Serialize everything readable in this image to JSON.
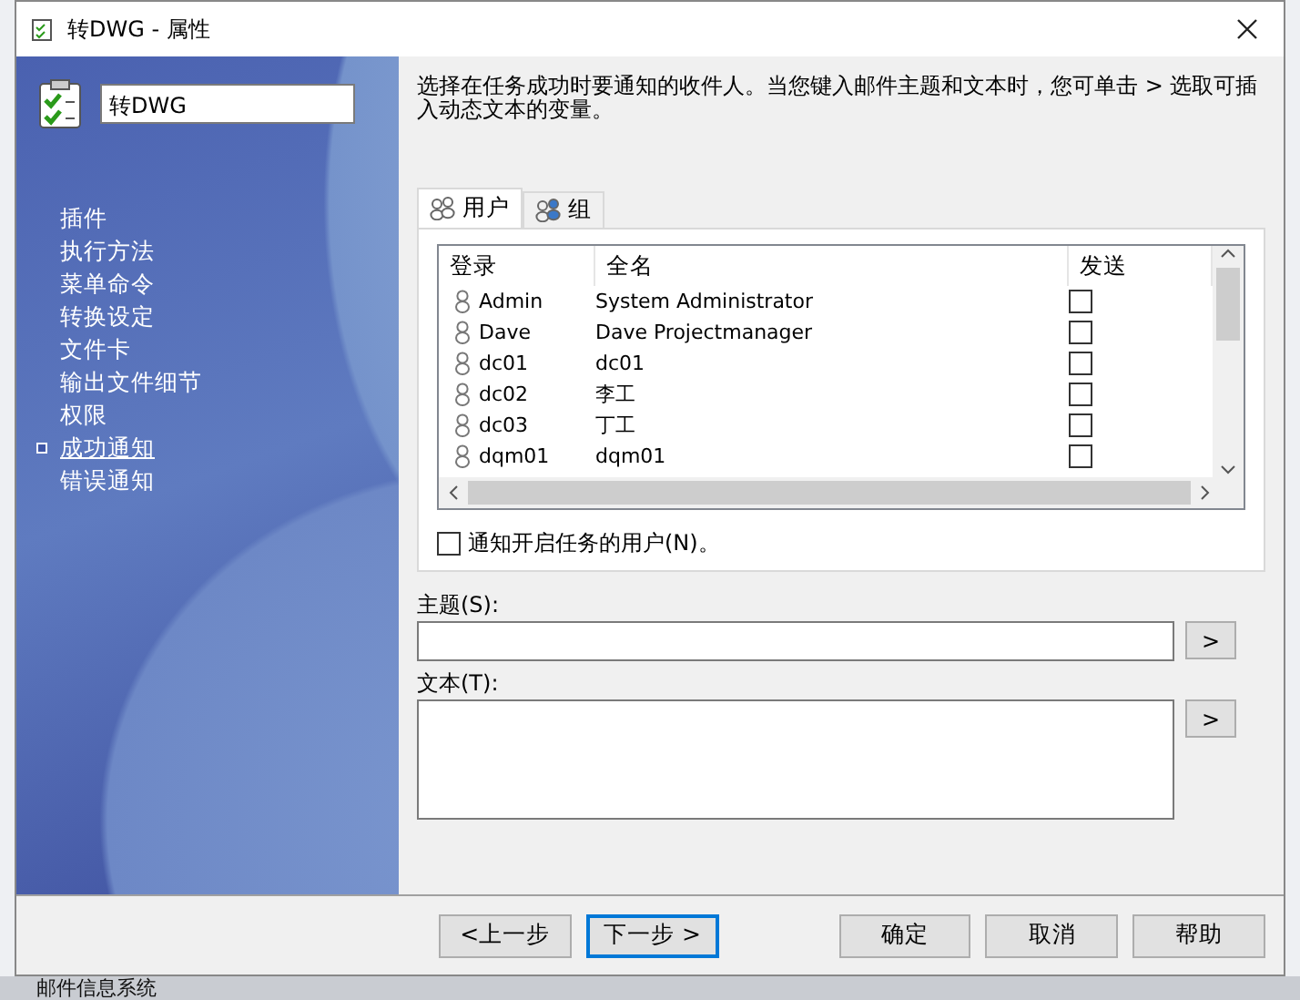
{
  "window": {
    "title": "转DWG - 属性"
  },
  "sidebar": {
    "name": "转DWG",
    "items": [
      {
        "label": "插件",
        "selected": false
      },
      {
        "label": "执行方法",
        "selected": false
      },
      {
        "label": "菜单命令",
        "selected": false
      },
      {
        "label": "转换设定",
        "selected": false
      },
      {
        "label": "文件卡",
        "selected": false
      },
      {
        "label": "输出文件细节",
        "selected": false
      },
      {
        "label": "权限",
        "selected": false
      },
      {
        "label": "成功通知",
        "selected": true
      },
      {
        "label": "错误通知",
        "selected": false
      }
    ]
  },
  "description": "选择在任务成功时要通知的收件人。当您键入邮件主题和文本时，您可单击 > 选取可插入动态文本的变量。",
  "tabs": [
    {
      "label": "用户",
      "selected": true
    },
    {
      "label": "组",
      "selected": false
    }
  ],
  "table": {
    "columns": [
      "登录",
      "全名",
      "发送"
    ],
    "rows": [
      {
        "login": "Admin",
        "full_name": "System Administrator",
        "send": false
      },
      {
        "login": "Dave",
        "full_name": "Dave Projectmanager",
        "send": false
      },
      {
        "login": "dc01",
        "full_name": "dc01",
        "send": false
      },
      {
        "login": "dc02",
        "full_name": "李工",
        "send": false
      },
      {
        "login": "dc03",
        "full_name": "丁工",
        "send": false
      },
      {
        "login": "dqm01",
        "full_name": "dqm01",
        "send": false
      }
    ]
  },
  "notify_starter": {
    "label": "通知开启任务的用户(N)。",
    "checked": false
  },
  "subject": {
    "label": "主题(S):",
    "button": ">"
  },
  "body": {
    "label": "文本(T):",
    "button": ">"
  },
  "buttons": [
    {
      "label": "<上一步",
      "focused": false
    },
    {
      "label": "下一步 >",
      "focused": true
    },
    {
      "label": "确定",
      "focused": false
    },
    {
      "label": "取消",
      "focused": false
    },
    {
      "label": "帮助",
      "focused": false
    }
  ],
  "background_window": {
    "text": "邮件信息系统"
  }
}
